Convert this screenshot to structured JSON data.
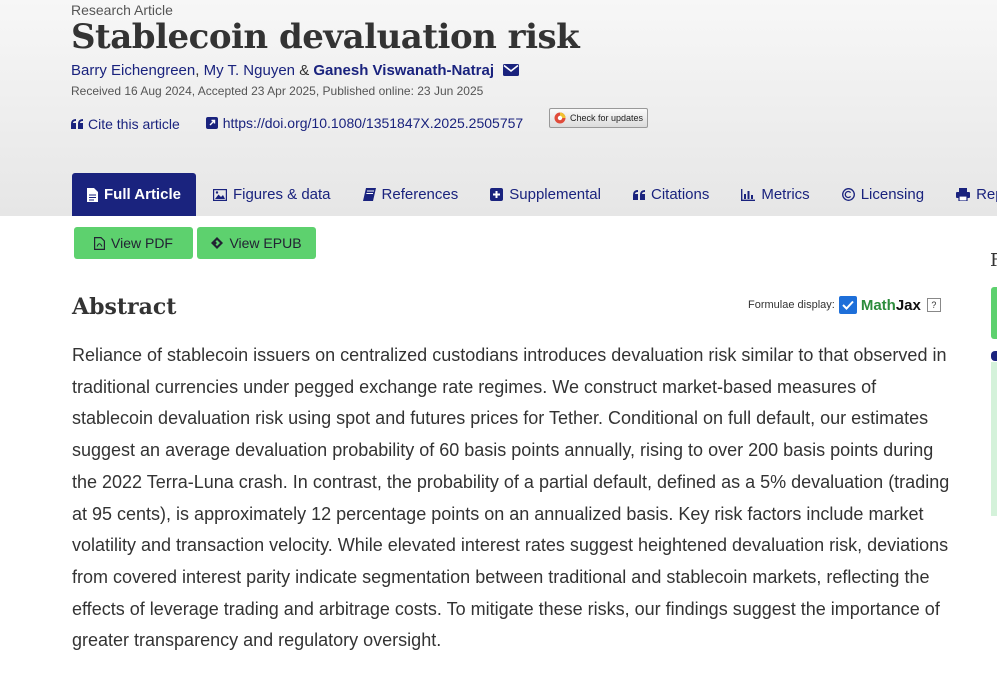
{
  "article": {
    "type": "Research Article",
    "title": "Stablecoin devaluation risk",
    "authors": [
      {
        "name": "Barry Eichengreen",
        "sep": ","
      },
      {
        "name": "My T. Nguyen",
        "sep": "&"
      },
      {
        "name": "Ganesh Viswanath-Natraj"
      }
    ],
    "dates": "Received 16 Aug 2024, Accepted 23 Apr 2025, Published online: 23 Jun 2025",
    "cite_label": "Cite this article",
    "doi": "https://doi.org/10.1080/1351847X.2025.2505757",
    "check_updates": "Check for updates"
  },
  "tabs": [
    {
      "label": "Full Article",
      "icon": "file-icon",
      "active": true
    },
    {
      "label": "Figures & data",
      "icon": "image-icon"
    },
    {
      "label": "References",
      "icon": "book-icon"
    },
    {
      "label": "Supplemental",
      "icon": "plus-square-icon"
    },
    {
      "label": "Citations",
      "icon": "quote-icon"
    },
    {
      "label": "Metrics",
      "icon": "bar-chart-icon"
    },
    {
      "label": "Licensing",
      "icon": "copyright-icon"
    },
    {
      "label": "Reprin",
      "icon": "print-icon"
    }
  ],
  "buttons": {
    "view_pdf": "View PDF",
    "view_epub": "View EPUB"
  },
  "abstract": {
    "heading": "Abstract",
    "formulae_label": "Formulae display:",
    "mathjax_math": "Math",
    "mathjax_jax": "Jax",
    "help": "?",
    "text": "Reliance of stablecoin issuers on centralized custodians introduces devaluation risk similar to that observed in traditional currencies under pegged exchange rate regimes. We construct market-based measures of stablecoin devaluation risk using spot and futures prices for Tether. Conditional on full default, our estimates suggest an average devaluation probability of 60 basis points annually, rising to over 200 basis points during the 2022 Terra-Luna crash. In contrast, the probability of a partial default, defined as a 5% devaluation (trading at 95 cents), is approximately 12 percentage points on an annualized basis. Key risk factors include market volatility and transaction velocity. While elevated interest rates suggest heightened devaluation risk, deviations from covered interest parity indicate segmentation between traditional and stablecoin markets, reflecting the effects of leverage trading and arbitrage costs. To mitigate these risks, our findings suggest the importance of greater transparency and regulatory oversight."
  },
  "sidebar_partial": {
    "letter": "F"
  },
  "colors": {
    "brand_navy": "#1a237e",
    "button_green": "#5dd16e",
    "header_grey": "#eeeeee"
  }
}
